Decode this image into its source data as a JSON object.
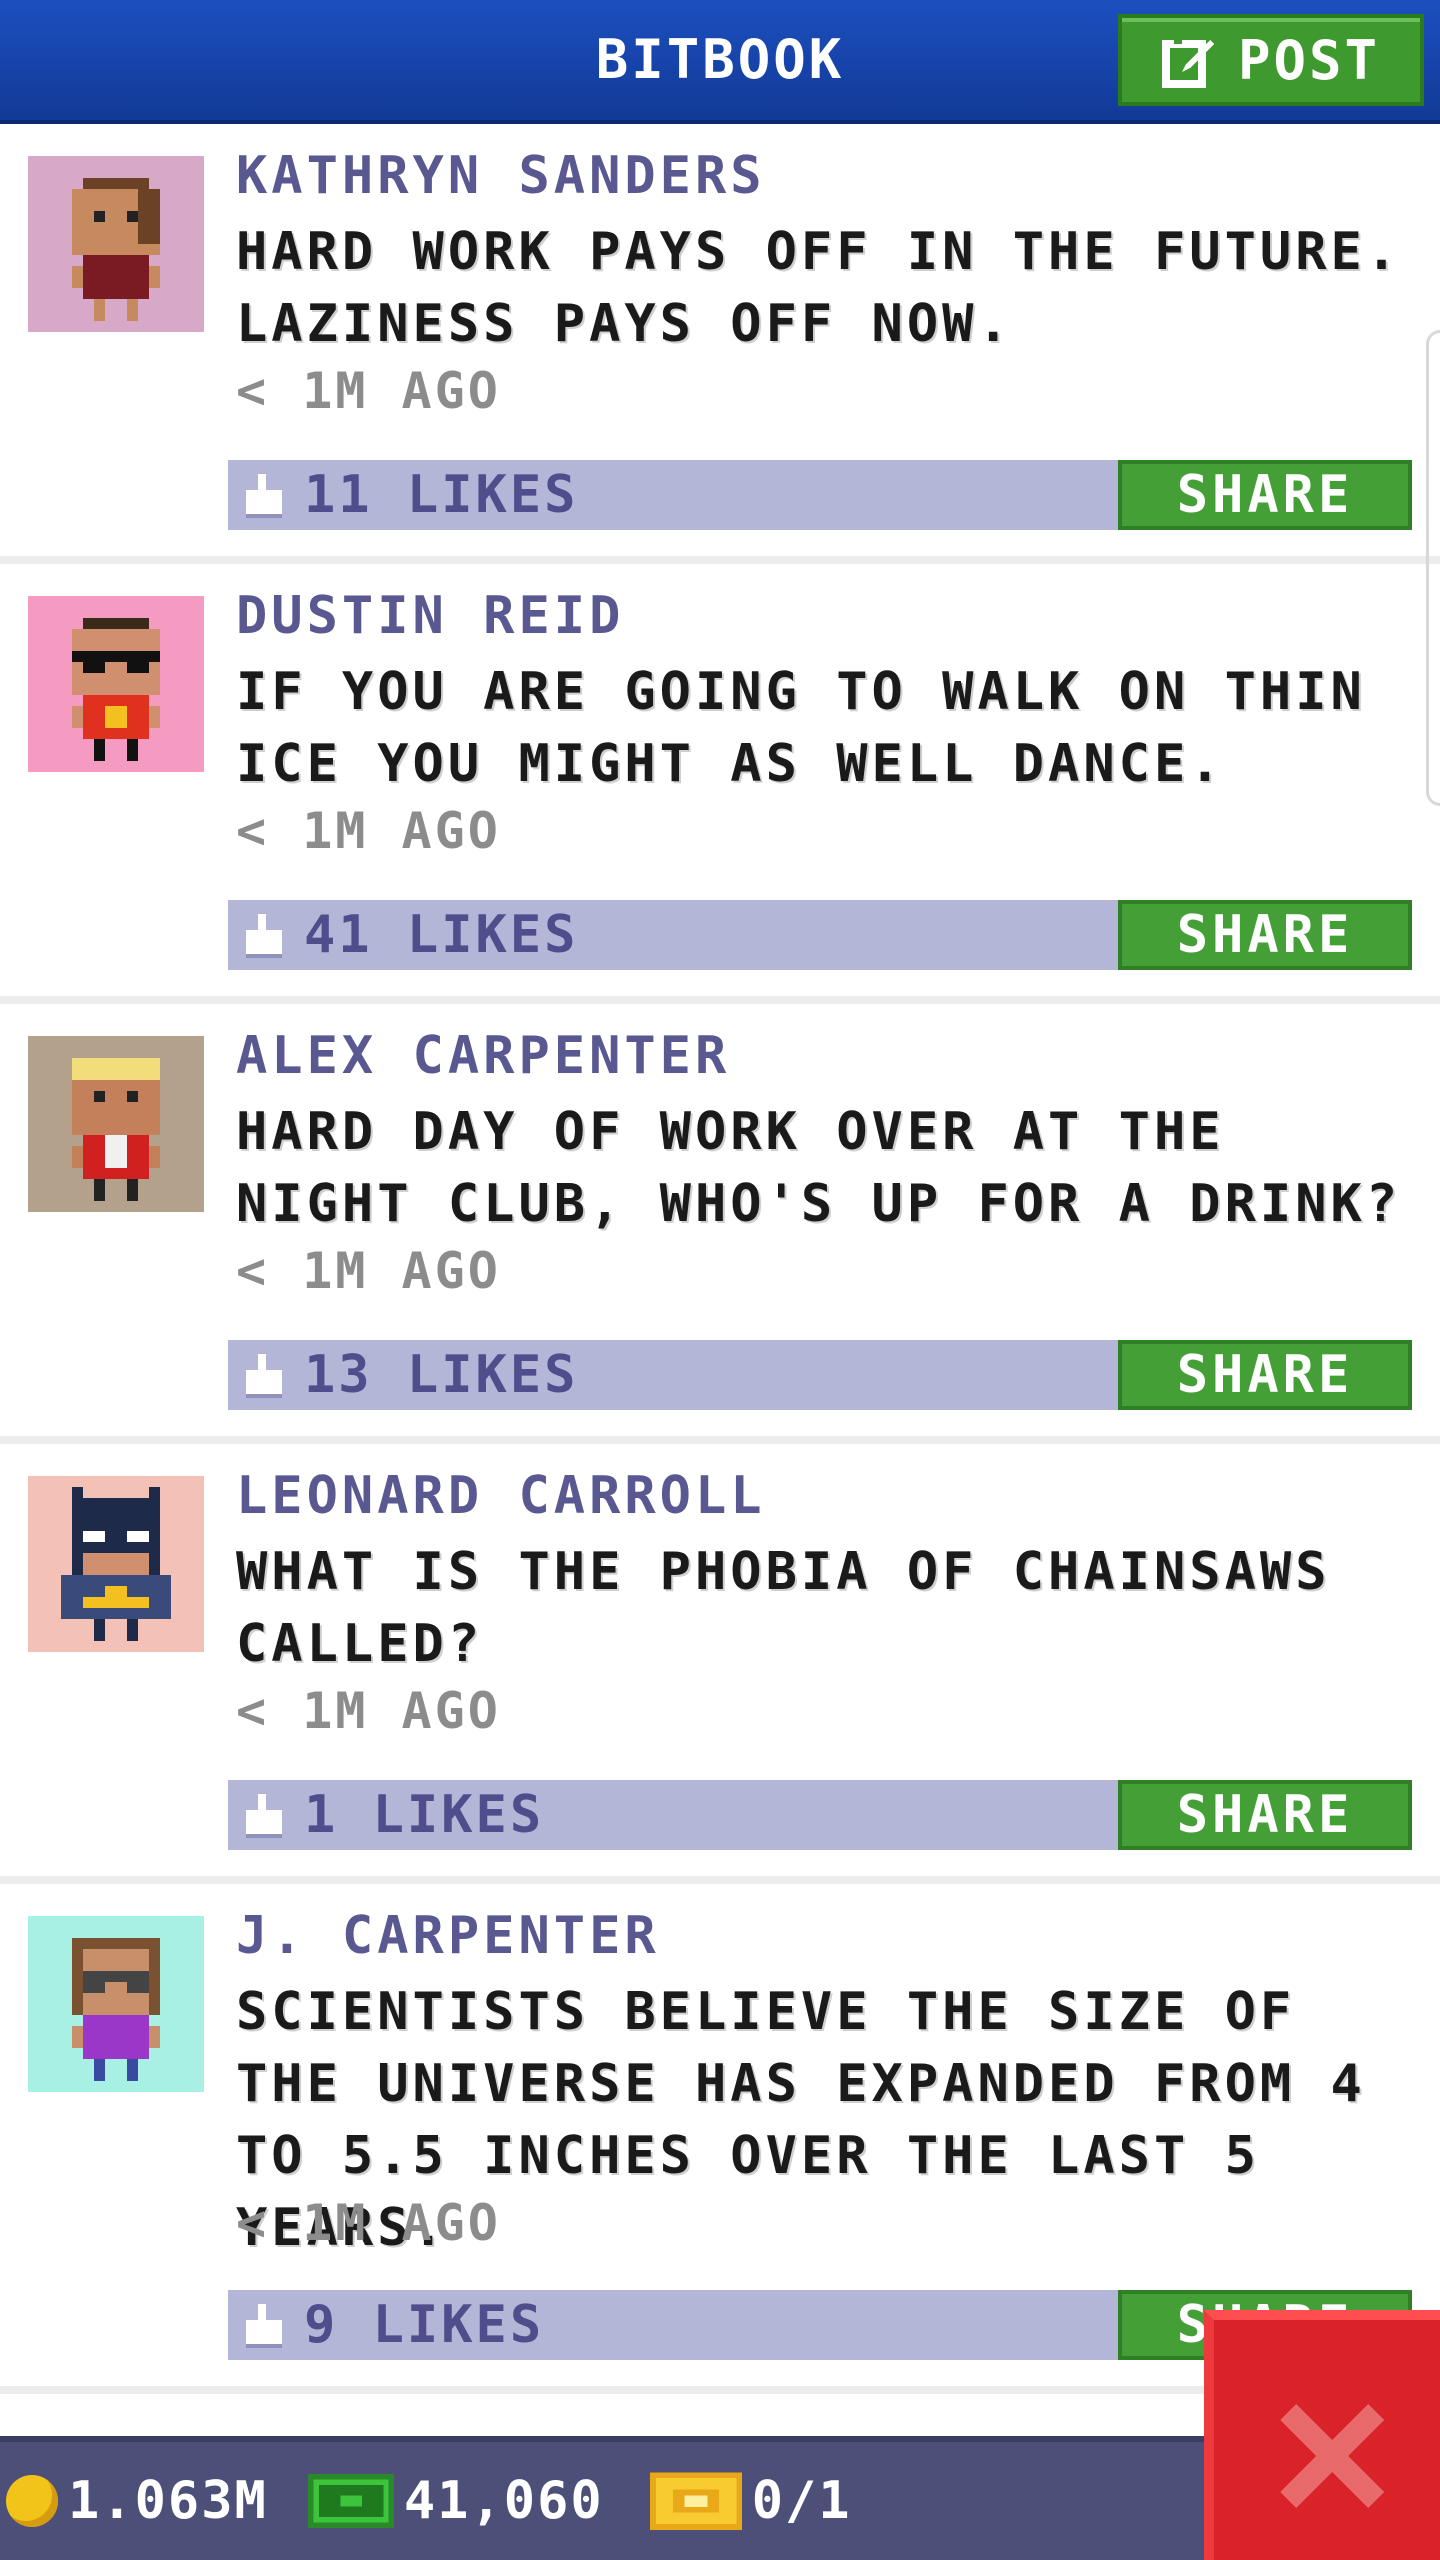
{
  "header": {
    "title": "BITBOOK",
    "post_label": "POST"
  },
  "posts": [
    {
      "name": "KATHRYN SANDERS",
      "text": "HARD WORK PAYS OFF IN THE FUTURE. LAZINESS PAYS OFF NOW.",
      "time": "< 1M AGO",
      "likes": "11 LIKES",
      "share_label": "SHARE",
      "avatar_bg": "#d8a8c8"
    },
    {
      "name": "DUSTIN REID",
      "text": "IF YOU ARE GOING TO WALK ON THIN ICE YOU MIGHT AS WELL DANCE.",
      "time": "< 1M AGO",
      "likes": "41 LIKES",
      "share_label": "SHARE",
      "avatar_bg": "#f59ac0"
    },
    {
      "name": "ALEX CARPENTER",
      "text": "HARD DAY OF WORK OVER AT THE NIGHT CLUB, WHO'S UP FOR A DRINK?",
      "time": "< 1M AGO",
      "likes": "13 LIKES",
      "share_label": "SHARE",
      "avatar_bg": "#b3a18c"
    },
    {
      "name": "LEONARD CARROLL",
      "text": "WHAT IS THE PHOBIA OF CHAINSAWS CALLED?",
      "time": "< 1M AGO",
      "likes": "1 LIKES",
      "share_label": "SHARE",
      "avatar_bg": "#f3c1b5"
    },
    {
      "name": "J. CARPENTER",
      "text": "SCIENTISTS BELIEVE THE SIZE OF THE UNIVERSE HAS EXPANDED FROM 4 TO 5.5 INCHES OVER THE LAST 5 YEARS.",
      "time": "< 1M AGO",
      "likes": "9 LIKES",
      "share_label": "SHARE",
      "avatar_bg": "#a8f0e4"
    }
  ],
  "status_bar": {
    "coins": "1.063M",
    "cash": "41,060",
    "tickets": "0/1"
  },
  "colors": {
    "header_blue": "#1c4fbf",
    "share_green": "#44a036",
    "like_bar": "#b4b6d8",
    "close_red": "#d9222a"
  },
  "icons": {
    "post": "edit-icon",
    "like": "thumbs-up-icon",
    "coin": "coin-icon",
    "cash": "cash-icon",
    "tickets": "ticket-icon",
    "close": "close-icon"
  }
}
